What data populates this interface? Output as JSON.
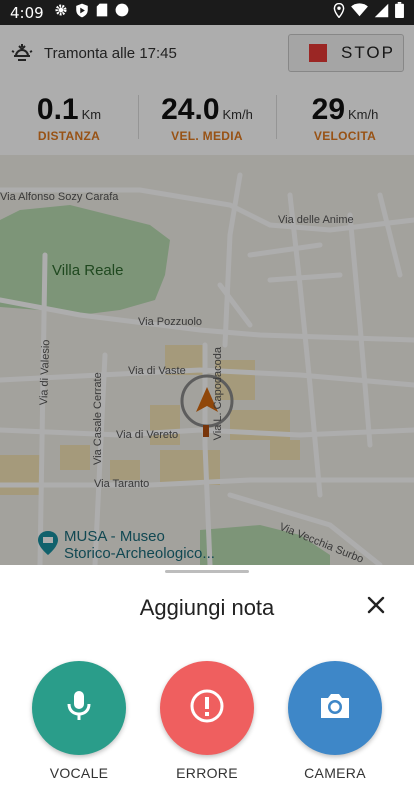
{
  "status_bar": {
    "time": "4:09",
    "left_icons": [
      "gear-icon",
      "shield-play-icon",
      "sd-card-icon",
      "circle-icon"
    ],
    "right_icons": [
      "location-icon",
      "wifi-icon",
      "signal-icon",
      "battery-icon"
    ]
  },
  "header": {
    "sunset_text": "Tramonta alle 17:45",
    "stop_label": "STOP"
  },
  "stats": [
    {
      "value": "0.1",
      "unit": "Km",
      "caption": "DISTANZA"
    },
    {
      "value": "24.0",
      "unit": "Km/h",
      "caption": "VEL. MEDIA"
    },
    {
      "value": "29",
      "unit": "Km/h",
      "caption": "VELOCITA"
    }
  ],
  "map": {
    "labels": {
      "street_sozy_carafa": "Via Alfonso Sozy Carafa",
      "street_anime": "Via delle Anime",
      "park_villa_reale": "Villa Reale",
      "street_pozzuolo": "Via Pozzuolo",
      "street_valesio": "Via di Valesio",
      "street_vaste": "Via di Vaste",
      "street_lucapodocoda": "Via L. Capodacoda",
      "street_casale_cerrate": "Via Casale Cerrate",
      "street_vereto": "Via di Vereto",
      "street_taranto": "Via Taranto",
      "street_vecchia_surbo": "Via Vecchia Surbo",
      "poi_musa": "MUSA - Museo\nStorico-Archeologico..."
    }
  },
  "sheet": {
    "title": "Aggiungi nota",
    "actions": [
      {
        "label": "VOCALE",
        "icon": "microphone-icon",
        "color": "#2a9d8a"
      },
      {
        "label": "ERRORE",
        "icon": "alert-icon",
        "color": "#ef5f5f"
      },
      {
        "label": "CAMERA",
        "icon": "camera-icon",
        "color": "#3e87c8"
      }
    ]
  },
  "colors": {
    "accent_orange": "#e07a1f",
    "stop_red": "#e53935"
  }
}
